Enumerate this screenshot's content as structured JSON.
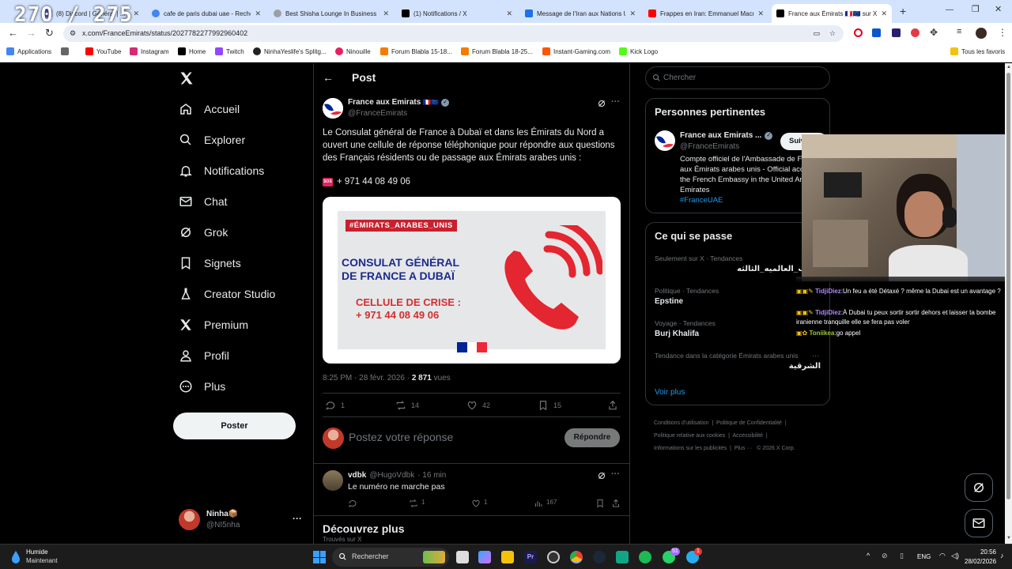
{
  "overlay_counter": "270 / 275",
  "browser": {
    "tabs": [
      {
        "label": "(8) Discord | Général | ...",
        "color": "#5865f2"
      },
      {
        "label": "cafe de paris dubai uae - Recherche",
        "color": "#4285f4"
      },
      {
        "label": "Best Shisha Lounge In Business Bay",
        "color": "#888888"
      },
      {
        "label": "(1) Notifications / X",
        "color": "#000000"
      },
      {
        "label": "Message de l'Iran aux Nations Unies",
        "color": "#1a73e8"
      },
      {
        "label": "Frappes en Iran: Emmanuel Macron",
        "color": "#ff0000"
      },
      {
        "label": "France aux Émirats 🇫🇷🇪🇺 sur X :",
        "color": "#000000"
      }
    ],
    "url": "x.com/FranceEmirats/status/2027782277992960402",
    "bookmarks": [
      "Applications",
      "YouTube",
      "Instagram",
      "Home",
      "Twitch",
      "NinhaYeslife's Splitg...",
      "Ninouille",
      "Forum Blabla 15-18...",
      "Forum Blabla 18-25...",
      "Instant-Gaming.com",
      "Kick Logo"
    ],
    "all_bookmarks": "Tous les favoris"
  },
  "sidebar": {
    "items": [
      {
        "label": "Accueil",
        "icon": "home-icon"
      },
      {
        "label": "Explorer",
        "icon": "search-icon"
      },
      {
        "label": "Notifications",
        "icon": "bell-icon"
      },
      {
        "label": "Chat",
        "icon": "mail-icon"
      },
      {
        "label": "Grok",
        "icon": "grok-icon"
      },
      {
        "label": "Signets",
        "icon": "bookmark-icon"
      },
      {
        "label": "Creator Studio",
        "icon": "flask-icon"
      },
      {
        "label": "Premium",
        "icon": "x-logo-icon"
      },
      {
        "label": "Profil",
        "icon": "person-icon"
      },
      {
        "label": "Plus",
        "icon": "more-circle-icon"
      }
    ],
    "post_button": "Poster",
    "account": {
      "name": "Ninha📦",
      "handle": "@NI5nha"
    }
  },
  "main": {
    "header": "Post",
    "tweet": {
      "author": "France aux Emirats",
      "author_flags": "🇫🇷🇪🇺",
      "handle": "@FranceEmirats",
      "text": "Le Consulat général de France à Dubaï et dans les Émirats du Nord a ouvert une cellule de réponse téléphonique pour répondre aux questions des Français résidents ou de passage aux Émirats arabes unis :",
      "phone_line": "+ 971 44 08 49 06",
      "image": {
        "hashtag": "#ÉMIRATS_ARABES_UNIS",
        "title_line1": "CONSULAT GÉNÉRAL",
        "title_line2": "DE FRANCE A DUBAÏ",
        "crisis_line1": "CELLULE DE CRISE :",
        "crisis_line2": "+ 971 44 08 49 06"
      },
      "time": "8:25 PM · 28 févr. 2026 · ",
      "views_count": "2 871",
      "views_label": " vues",
      "stats": {
        "replies": "1",
        "reposts": "14",
        "likes": "42",
        "bookmarks": "15"
      }
    },
    "reply_placeholder": "Postez votre réponse",
    "reply_button": "Répondre",
    "reply": {
      "author": "vdbk",
      "handle": "@HugoVdbk",
      "time": "· 16 min",
      "text": "Le numéro ne marche pas",
      "stats": {
        "replies": "",
        "reposts": "1",
        "likes": "1",
        "views": "167"
      }
    },
    "discover_title": "Découvrez plus",
    "discover_sub": "Trouvés sur X"
  },
  "right": {
    "search_placeholder": "Chercher",
    "relevant": {
      "title": "Personnes pertinentes",
      "name": "France aux Emirats ...",
      "handle": "@FranceEmirats",
      "follow": "Suivre",
      "bio": "Compte officiel de l'Ambassade de France aux Émirats arabes unis - Official account of the French Embassy in the United Arab Emirates",
      "bio_tag": "#FranceUAE"
    },
    "trends": {
      "title": "Ce qui se passe",
      "items": [
        {
          "context": "Seulement sur X · Tendances",
          "name": "الحرب_العالميه_الثالثه"
        },
        {
          "context": "Politique · Tendances",
          "name": "Epstine"
        },
        {
          "context": "Voyage · Tendances",
          "name": "Burj Khalifa"
        },
        {
          "context": "Tendance dans la catégorie Émirats arabes unis",
          "name": "الشرقية"
        }
      ],
      "more": "Voir plus"
    },
    "footer": [
      "Conditions d'utilisation",
      "Politique de Confidentialité",
      "Politique relative aux cookies",
      "Accessibilité",
      "Informations sur les publicités",
      "Plus ···",
      "© 2026 X Corp."
    ]
  },
  "stream_chat": [
    {
      "user": "TidjiDiez",
      "user_color": "#b389ff",
      "text": "Un feu a été Détaxé ? même la Dubai est un avantage ?"
    },
    {
      "user": "TidjiDiez",
      "user_color": "#b389ff",
      "text": "À Dubai tu peux sortir sortir dehors et laisser ta bombe iranienne tranquille elle se fera pas voler"
    },
    {
      "user": "Toniikea",
      "user_color": "#9acd32",
      "text": "go appel"
    }
  ],
  "taskbar": {
    "weather_title": "Humide",
    "weather_sub": "Maintenant",
    "search": "Rechercher",
    "lang": "ENG",
    "time": "20:56",
    "date": "28/02/2026",
    "badge_a": "51",
    "badge_b": "1"
  }
}
